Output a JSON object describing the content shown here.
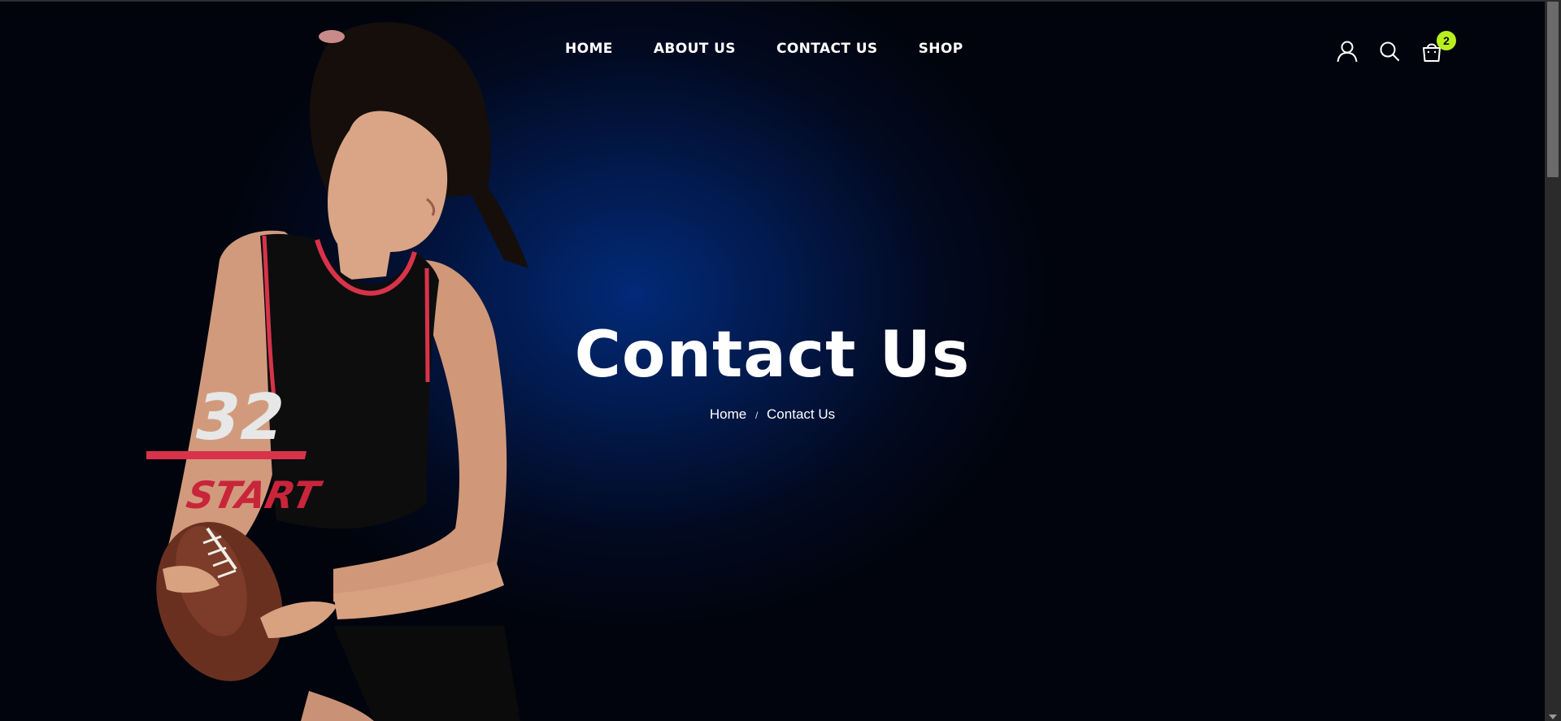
{
  "nav": {
    "items": [
      {
        "label": "HOME"
      },
      {
        "label": "ABOUT US"
      },
      {
        "label": "CONTACT US"
      },
      {
        "label": "SHOP"
      }
    ]
  },
  "header_icons": {
    "account": "user-icon",
    "search": "search-icon",
    "cart": "shopping-bag-icon",
    "cart_count": "2"
  },
  "hero": {
    "title": "Contact Us",
    "breadcrumb": {
      "home": "Home",
      "separator": "/",
      "current": "Contact Us"
    },
    "image": {
      "jersey_number": "32",
      "jersey_text": "START"
    }
  },
  "colors": {
    "badge": "#b8f01e",
    "glow": "#022a78"
  }
}
